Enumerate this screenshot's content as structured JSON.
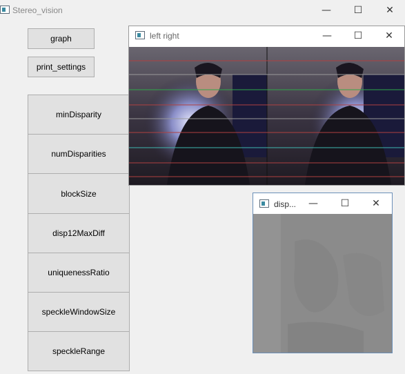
{
  "main_window": {
    "title": "Stereo_vision",
    "buttons": {
      "graph": "graph",
      "print_settings": "print_settings"
    },
    "params": [
      "minDisparity",
      "numDisparities",
      "blockSize",
      "disp12MaxDiff",
      "uniquenessRatio",
      "speckleWindowSize",
      "speckleRange"
    ]
  },
  "left_right_window": {
    "title": "left right"
  },
  "disp_window": {
    "title": "disp..."
  },
  "controls": {
    "minimize": "—",
    "maximize": "☐",
    "close": "✕"
  },
  "colors": {
    "background": "#f0f0f0",
    "button": "#e1e1e1",
    "button_border": "#adadad",
    "disparity_gray": "#8f8f8f",
    "epipolar_red": "#b04040",
    "epipolar_green": "#2fa84a",
    "epipolar_cyan": "#3fb8b0"
  }
}
